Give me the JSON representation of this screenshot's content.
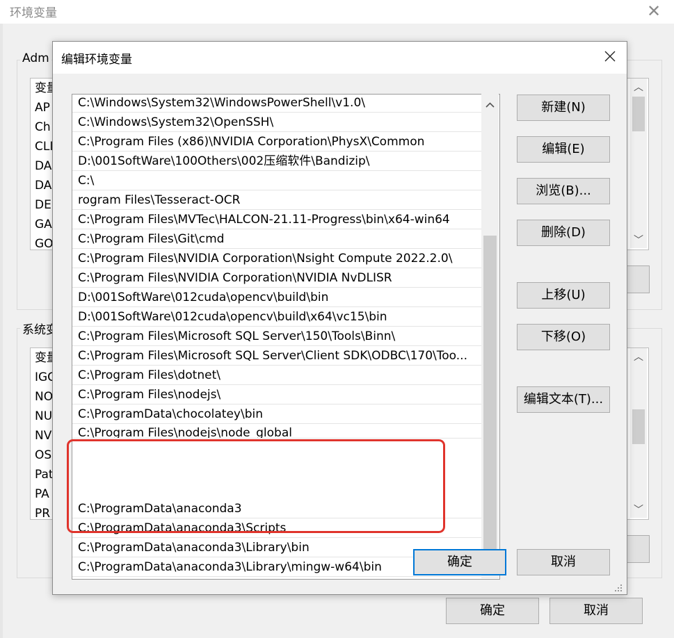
{
  "background_window": {
    "title": "环境变量",
    "user_group_label": "Adm",
    "system_group_label": "系统变",
    "user_vars_header": "变量",
    "user_vars": [
      "AP",
      "Ch",
      "CLI",
      "DA",
      "DA",
      "DE",
      "GA",
      "GO"
    ],
    "system_vars_header": "变量",
    "system_vars": [
      "IGC",
      "NO",
      "NU",
      "NV",
      "OS",
      "Pat",
      "PA",
      "PR"
    ],
    "ok_label": "确定",
    "cancel_label": "取消"
  },
  "dialog": {
    "title": "编辑环境变量",
    "paths": [
      "C:\\Windows\\System32\\WindowsPowerShell\\v1.0\\",
      "C:\\Windows\\System32\\OpenSSH\\",
      "C:\\Program Files (x86)\\NVIDIA Corporation\\PhysX\\Common",
      "D:\\001SoftWare\\100Others\\002压缩软件\\Bandizip\\",
      "C:\\",
      "rogram Files\\Tesseract-OCR",
      "C:\\Program Files\\MVTec\\HALCON-21.11-Progress\\bin\\x64-win64",
      "C:\\Program Files\\Git\\cmd",
      "C:\\Program Files\\NVIDIA Corporation\\Nsight Compute 2022.2.0\\",
      "C:\\Program Files\\NVIDIA Corporation\\NVIDIA NvDLISR",
      "D:\\001SoftWare\\012cuda\\opencv\\build\\bin",
      "D:\\001SoftWare\\012cuda\\opencv\\build\\x64\\vc15\\bin",
      "C:\\Program Files\\Microsoft SQL Server\\150\\Tools\\Binn\\",
      "C:\\Program Files\\Microsoft SQL Server\\Client SDK\\ODBC\\170\\Too...",
      "C:\\Program Files\\dotnet\\",
      "C:\\Program Files\\nodejs\\",
      "C:\\ProgramData\\chocolatey\\bin",
      "C:\\Program Files\\nodejs\\node_global",
      "C:\\ProgramData\\anaconda3",
      "C:\\ProgramData\\anaconda3\\Scripts",
      "C:\\ProgramData\\anaconda3\\Library\\bin",
      "C:\\ProgramData\\anaconda3\\Library\\mingw-w64\\bin"
    ],
    "buttons": {
      "new": "新建(N)",
      "edit": "编辑(E)",
      "browse": "浏览(B)...",
      "delete": "删除(D)",
      "move_up": "上移(U)",
      "move_down": "下移(O)",
      "edit_text": "编辑文本(T)..."
    },
    "ok_label": "确定",
    "cancel_label": "取消"
  },
  "colors": {
    "highlight": "#e0342c",
    "default_button_border": "#0078d7"
  }
}
